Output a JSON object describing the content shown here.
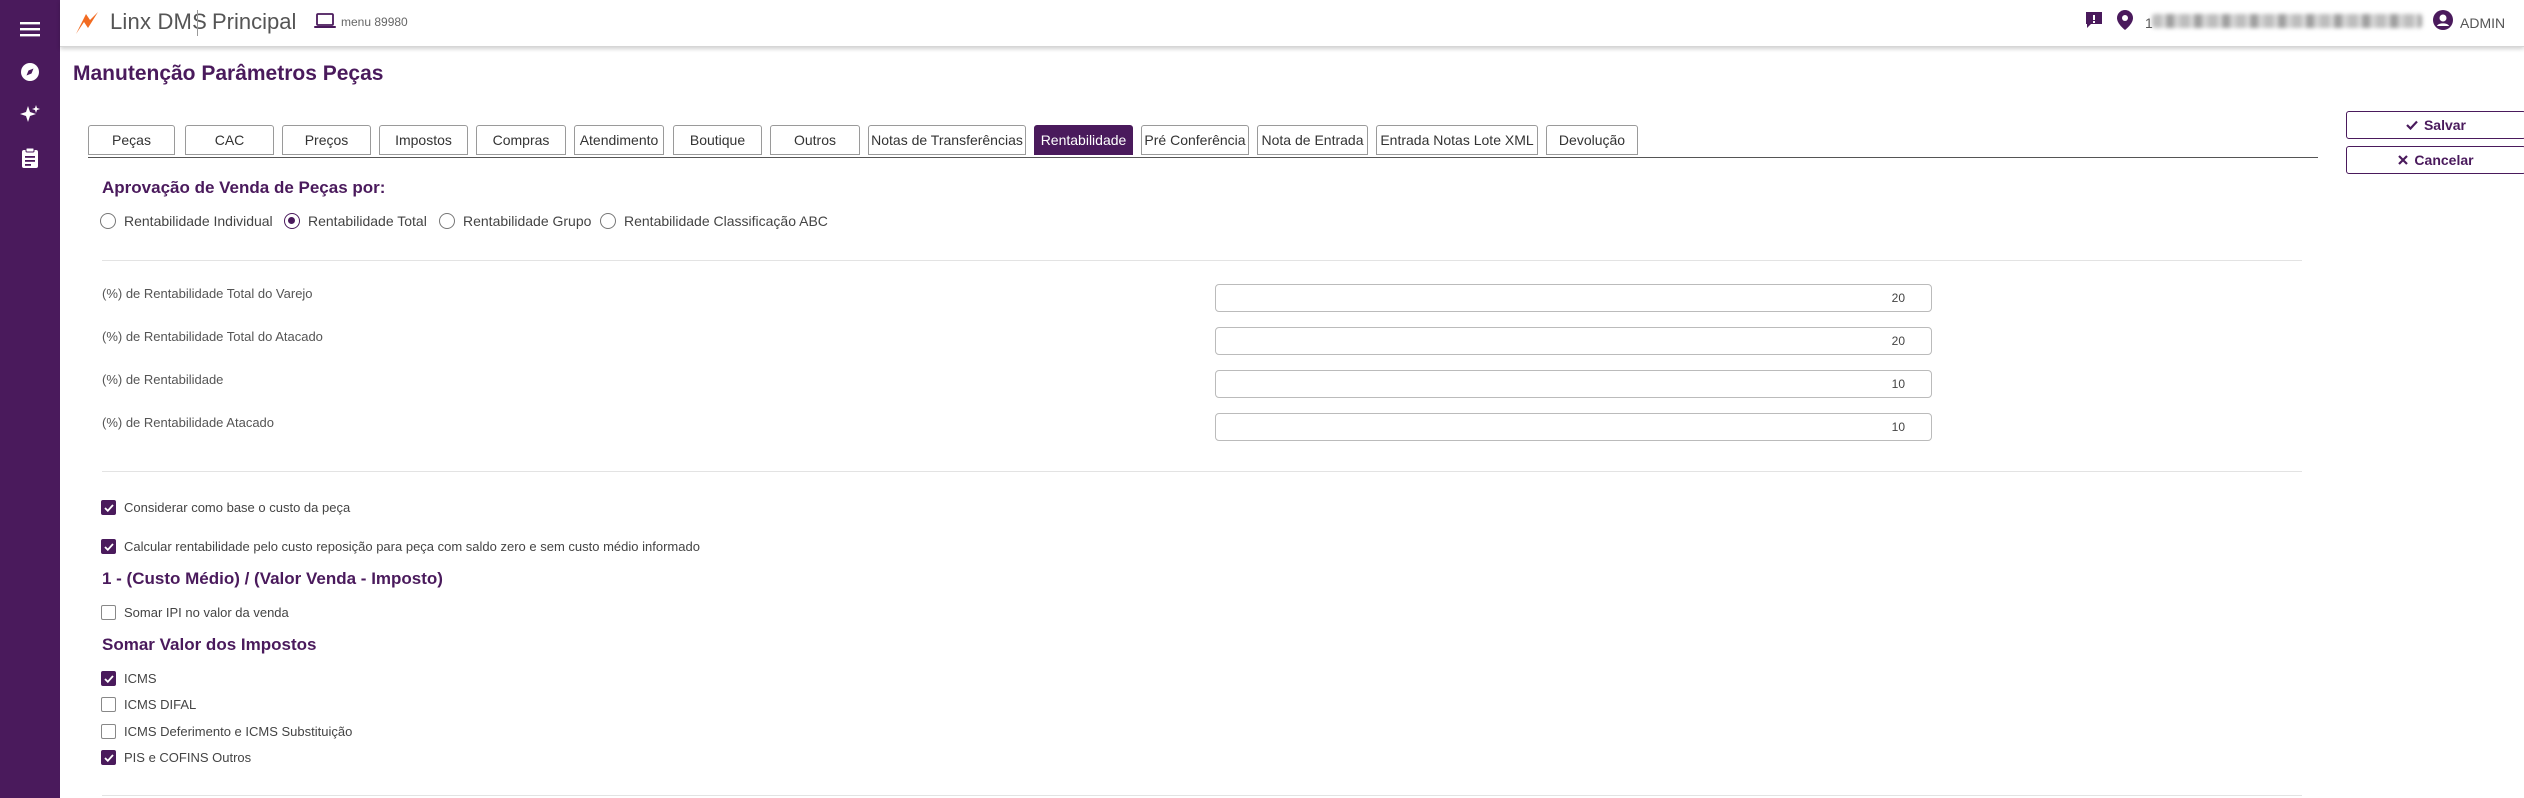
{
  "header": {
    "brand": "Linx DMS",
    "module": "Principal",
    "menu_text": "menu 89980",
    "location_prefix": "1",
    "user": "ADMIN"
  },
  "icons": {
    "sidebar": [
      "hamburger-icon",
      "compass-icon",
      "sparkle-icon",
      "clipboard-icon"
    ],
    "topbar": [
      "logo-icon",
      "laptop-icon",
      "chat-icon",
      "map-pin-icon",
      "user-circle-icon"
    ],
    "actions": [
      "check-icon",
      "x-icon"
    ]
  },
  "colors": {
    "primary": "#4a1a5c",
    "logo": "#f26b21"
  },
  "page": {
    "title": "Manutenção Parâmetros Peças"
  },
  "tabs": [
    {
      "label": "Peças",
      "active": false
    },
    {
      "label": "CAC",
      "active": false
    },
    {
      "label": "Preços",
      "active": false
    },
    {
      "label": "Impostos",
      "active": false
    },
    {
      "label": "Compras",
      "active": false
    },
    {
      "label": "Atendimento",
      "active": false
    },
    {
      "label": "Boutique",
      "active": false
    },
    {
      "label": "Outros",
      "active": false
    },
    {
      "label": "Notas de Transferências",
      "active": false
    },
    {
      "label": "Rentabilidade",
      "active": true
    },
    {
      "label": "Pré Conferência",
      "active": false
    },
    {
      "label": "Nota de Entrada",
      "active": false
    },
    {
      "label": "Entrada Notas Lote XML",
      "active": false
    },
    {
      "label": "Devolução",
      "active": false
    }
  ],
  "actions": {
    "save": "Salvar",
    "cancel": "Cancelar"
  },
  "approval": {
    "title": "Aprovação de Venda de Peças por:",
    "options": [
      {
        "label": "Rentabilidade Individual",
        "selected": false
      },
      {
        "label": "Rentabilidade Total",
        "selected": true
      },
      {
        "label": "Rentabilidade Grupo",
        "selected": false
      },
      {
        "label": "Rentabilidade Classificação ABC",
        "selected": false
      }
    ]
  },
  "fields": [
    {
      "label": "(%) de Rentabilidade Total do Varejo",
      "value": "20"
    },
    {
      "label": "(%) de Rentabilidade Total do Atacado",
      "value": "20"
    },
    {
      "label": "(%) de Rentabilidade",
      "value": "10"
    },
    {
      "label": "(%) de Rentabilidade Atacado",
      "value": "10"
    }
  ],
  "options": [
    {
      "label": "Considerar como base o custo da peça",
      "checked": true
    },
    {
      "label": "Calcular rentabilidade pelo custo reposição para peça com saldo zero e sem custo médio informado",
      "checked": true
    }
  ],
  "formula": {
    "title": "1 - (Custo Médio) / (Valor Venda - Imposto)",
    "ipi": {
      "label": "Somar IPI no valor da venda",
      "checked": false
    }
  },
  "taxes": {
    "title": "Somar Valor dos Impostos",
    "items": [
      {
        "label": "ICMS",
        "checked": true
      },
      {
        "label": "ICMS DIFAL",
        "checked": false
      },
      {
        "label": "ICMS Deferimento e ICMS Substituição",
        "checked": false
      },
      {
        "label": "PIS e COFINS Outros",
        "checked": true
      }
    ]
  }
}
